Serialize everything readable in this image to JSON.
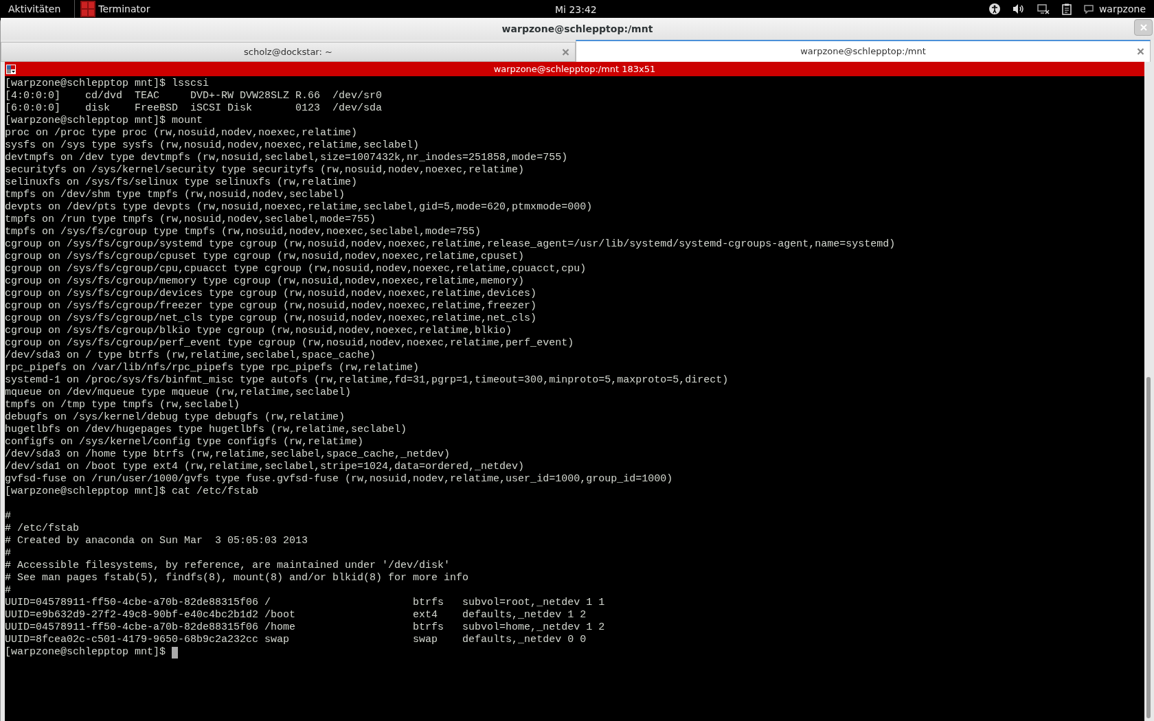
{
  "top_bar": {
    "activities": "Aktivitäten",
    "app_name": "Terminator",
    "clock": "Mi 23:42",
    "user": "warpzone"
  },
  "window": {
    "title": "warpzone@schlepptop:/mnt"
  },
  "tabs": [
    {
      "label": "scholz@dockstar: ~",
      "selected": false
    },
    {
      "label": "warpzone@schlepptop:/mnt",
      "selected": true
    }
  ],
  "terminal": {
    "title": "warpzone@schlepptop:/mnt 183x51",
    "lines": [
      {
        "text": "[warpzone@schlepptop mnt]$ lsscsi"
      },
      {
        "text": "[4:0:0:0]    cd/dvd  TEAC     DVD+-RW DVW28SLZ R.66  /dev/sr0"
      },
      {
        "text": "[6:0:0:0]    disk    FreeBSD  iSCSI Disk       0123  /dev/sda"
      },
      {
        "text": "[warpzone@schlepptop mnt]$ mount"
      },
      {
        "text": "proc on /proc type proc (rw,nosuid,nodev,noexec,relatime)"
      },
      {
        "text": "sysfs on /sys type sysfs (rw,nosuid,nodev,noexec,relatime,seclabel)"
      },
      {
        "text": "devtmpfs on /dev type devtmpfs (rw,nosuid,seclabel,size=1007432k,nr_inodes=251858,mode=755)"
      },
      {
        "text": "securityfs on /sys/kernel/security type securityfs (rw,nosuid,nodev,noexec,relatime)"
      },
      {
        "text": "selinuxfs on /sys/fs/selinux type selinuxfs (rw,relatime)"
      },
      {
        "text": "tmpfs on /dev/shm type tmpfs (rw,nosuid,nodev,seclabel)"
      },
      {
        "text": "devpts on /dev/pts type devpts (rw,nosuid,noexec,relatime,seclabel,gid=5,mode=620,ptmxmode=000)"
      },
      {
        "text": "tmpfs on /run type tmpfs (rw,nosuid,nodev,seclabel,mode=755)"
      },
      {
        "text": "tmpfs on /sys/fs/cgroup type tmpfs (rw,nosuid,nodev,noexec,seclabel,mode=755)"
      },
      {
        "text": "cgroup on /sys/fs/cgroup/systemd type cgroup (rw,nosuid,nodev,noexec,relatime,release_agent=/usr/lib/systemd/systemd-cgroups-agent,name=systemd)"
      },
      {
        "text": "cgroup on /sys/fs/cgroup/cpuset type cgroup (rw,nosuid,nodev,noexec,relatime,cpuset)"
      },
      {
        "text": "cgroup on /sys/fs/cgroup/cpu,cpuacct type cgroup (rw,nosuid,nodev,noexec,relatime,cpuacct,cpu)"
      },
      {
        "text": "cgroup on /sys/fs/cgroup/memory type cgroup (rw,nosuid,nodev,noexec,relatime,memory)"
      },
      {
        "text": "cgroup on /sys/fs/cgroup/devices type cgroup (rw,nosuid,nodev,noexec,relatime,devices)"
      },
      {
        "text": "cgroup on /sys/fs/cgroup/freezer type cgroup (rw,nosuid,nodev,noexec,relatime,freezer)"
      },
      {
        "text": "cgroup on /sys/fs/cgroup/net_cls type cgroup (rw,nosuid,nodev,noexec,relatime,net_cls)"
      },
      {
        "text": "cgroup on /sys/fs/cgroup/blkio type cgroup (rw,nosuid,nodev,noexec,relatime,blkio)"
      },
      {
        "text": "cgroup on /sys/fs/cgroup/perf_event type cgroup (rw,nosuid,nodev,noexec,relatime,perf_event)"
      },
      {
        "text": "/dev/sda3 on / type btrfs (rw,relatime,seclabel,space_cache)"
      },
      {
        "text": "rpc_pipefs on /var/lib/nfs/rpc_pipefs type rpc_pipefs (rw,relatime)"
      },
      {
        "text": "systemd-1 on /proc/sys/fs/binfmt_misc type autofs (rw,relatime,fd=31,pgrp=1,timeout=300,minproto=5,maxproto=5,direct)"
      },
      {
        "text": "mqueue on /dev/mqueue type mqueue (rw,relatime,seclabel)"
      },
      {
        "text": "tmpfs on /tmp type tmpfs (rw,seclabel)"
      },
      {
        "text": "debugfs on /sys/kernel/debug type debugfs (rw,relatime)"
      },
      {
        "text": "hugetlbfs on /dev/hugepages type hugetlbfs (rw,relatime,seclabel)"
      },
      {
        "text": "configfs on /sys/kernel/config type configfs (rw,relatime)"
      },
      {
        "text": "/dev/sda3 on /home type btrfs (rw,relatime,seclabel,space_cache,_netdev)"
      },
      {
        "text": "/dev/sda1 on /boot type ext4 (rw,relatime,seclabel,stripe=1024,data=ordered,_netdev)"
      },
      {
        "text": "gvfsd-fuse on /run/user/1000/gvfs type fuse.gvfsd-fuse (rw,nosuid,nodev,relatime,user_id=1000,group_id=1000)"
      },
      {
        "text": "[warpzone@schlepptop mnt]$ cat /etc/fstab"
      },
      {
        "text": "#",
        "blank_before": true
      },
      {
        "text": "# /etc/fstab"
      },
      {
        "text": "# Created by anaconda on Sun Mar  3 05:05:03 2013"
      },
      {
        "text": "#"
      },
      {
        "text": "# Accessible filesystems, by reference, are maintained under '/dev/disk'"
      },
      {
        "text": "# See man pages fstab(5), findfs(8), mount(8) and/or blkid(8) for more info"
      },
      {
        "text": "#"
      },
      {
        "text": "UUID=04578911-ff50-4cbe-a70b-82de88315f06 /                       btrfs   subvol=root,_netdev 1 1"
      },
      {
        "text": "UUID=e9b632d9-27f2-49c8-90bf-e40c4bc2b1d2 /boot                   ext4    defaults,_netdev 1 2"
      },
      {
        "text": "UUID=04578911-ff50-4cbe-a70b-82de88315f06 /home                   btrfs   subvol=home,_netdev 1 2"
      },
      {
        "text": "UUID=8fcea02c-c501-4179-9650-68b9c2a232cc swap                    swap    defaults,_netdev 0 0"
      },
      {
        "text": "[warpzone@schlepptop mnt]$",
        "cursor": true
      }
    ]
  }
}
